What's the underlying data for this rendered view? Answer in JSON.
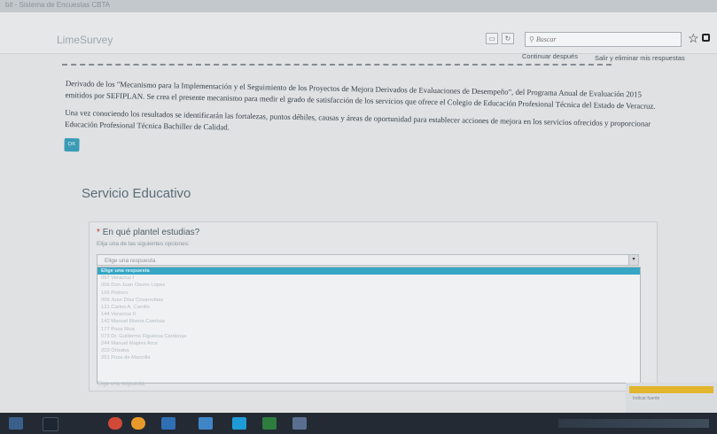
{
  "browser": {
    "tab_title": "bit - Sistema de Encuestas CBTA",
    "search_placeholder": "Buscar",
    "search_icon": "magnifier",
    "star_icon": "star",
    "download_icon": "download"
  },
  "header": {
    "logo": "LimeSurvey",
    "continue_later": "Continuar después",
    "exit_clear": "Salir y eliminar mis respuestas"
  },
  "intro": {
    "paragraph1": "Derivado de los \"Mecanismo para la Implementación y el Seguimiento de los Proyectos de Mejora Derivados de Evaluaciones de Desempeño\", del Programa Anual de Evaluación 2015 emitidos por SEFIPLAN. Se crea el presente mecanismo para medir el grado de satisfacción de los servicios que ofrece el Colegio de Educación Profesional Técnica del Estado de Veracruz.",
    "paragraph2": "Una vez conociendo los resultados se identificarán las fortalezas, puntos débiles, causas y áreas de oportunidad para establecer acciones de mejora en los servicios ofrecidos y proporcionar Educación Profesional Técnica Bachiller de Calidad.",
    "ok_label": "OK"
  },
  "group": {
    "title": "Servicio Educativo"
  },
  "question": {
    "mandatory_mark": "*",
    "text": "En qué plantel estudias?",
    "help": "Elija una de las siguientes opciones:",
    "select_value": "Elige una respuesta",
    "options": [
      "Elige una respuesta",
      "057 Veracruz I",
      "056 Don Juan Osorio López",
      "165 Potrero",
      "066 Juan Díaz Covarrubias",
      "121 Carlos A. Carrillo",
      "144 Veracruz II",
      "142 Manuel Rivera Cambas",
      "177 Poza Rica",
      "073 Dr. Guillermo Figueroa Cárdenas",
      "244 Manuel Maples Arce",
      "203 Orizaba",
      "251 Poza de Mancilla"
    ],
    "below_dropdown": "Elige una respuesta"
  },
  "side_panel": {
    "text": "Indicar fuente"
  },
  "colors": {
    "accent": "#36a6c4",
    "heading": "#5b6c75",
    "mandatory": "#c9302c"
  }
}
